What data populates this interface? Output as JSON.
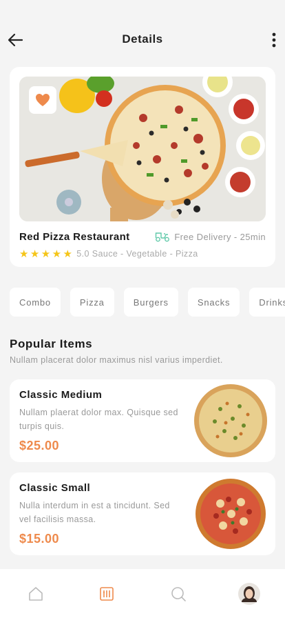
{
  "header": {
    "title": "Details"
  },
  "restaurant": {
    "name": "Red Pizza Restaurant",
    "delivery": "Free Delivery - 25min",
    "rating_meta": "5.0 Sauce - Vegetable - Pizza",
    "stars": 5,
    "favorited": true
  },
  "categories": [
    "Combo",
    "Pizza",
    "Burgers",
    "Snacks",
    "Drinks"
  ],
  "popular": {
    "title": "Popular Items",
    "subtitle": "Nullam placerat dolor maximus nisl varius imperdiet.",
    "items": [
      {
        "name": "Classic Medium",
        "desc": "Nullam plaerat dolor max. Quisque sed turpis quis.",
        "price": "$25.00"
      },
      {
        "name": "Classic Small",
        "desc": "Nulla interdum in est a tincidunt. Sed vel facilisis massa.",
        "price": "$15.00"
      }
    ]
  },
  "nav": [
    "home-icon",
    "menu-icon",
    "search-icon",
    "profile-avatar"
  ],
  "colors": {
    "accent": "#ee8a4c",
    "delivery_icon": "#5fc9a9",
    "star": "#f5c518"
  }
}
